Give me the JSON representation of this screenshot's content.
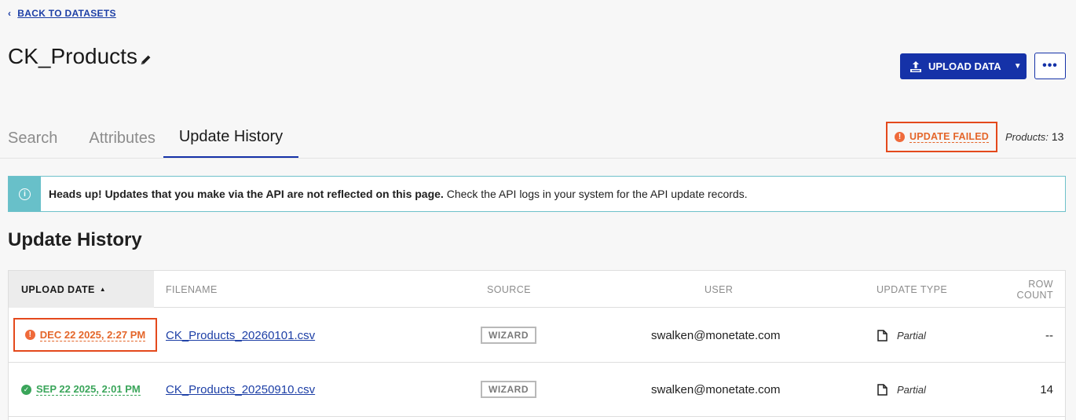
{
  "nav": {
    "back_label": "BACK TO DATASETS"
  },
  "header": {
    "title": "CK_Products",
    "upload_label": "UPLOAD DATA",
    "more_label": "•••"
  },
  "tabs": [
    {
      "label": "Search",
      "active": false
    },
    {
      "label": "Attributes",
      "active": false
    },
    {
      "label": "Update History",
      "active": true
    }
  ],
  "status": {
    "label": "UPDATE FAILED",
    "products_label": "Products:",
    "products_count": "13"
  },
  "banner": {
    "bold_text": "Heads up! Updates that you make via the API are not reflected on this page.",
    "text": " Check the API logs in your system for the API update records."
  },
  "section_title": "Update History",
  "table": {
    "columns": {
      "upload_date": "UPLOAD DATE",
      "filename": "FILENAME",
      "source": "SOURCE",
      "user": "USER",
      "update_type": "UPDATE TYPE",
      "row_count_1": "ROW",
      "row_count_2": "COUNT"
    },
    "rows": [
      {
        "status": "failed",
        "date": "DEC 22 2025, 2:27 PM",
        "filename": "CK_Products_20260101.csv",
        "source": "WIZARD",
        "user": "swalken@monetate.com",
        "update_type": "Partial",
        "row_count": "--"
      },
      {
        "status": "success",
        "date": "SEP 22 2025, 2:01 PM",
        "filename": "CK_Products_20250910.csv",
        "source": "WIZARD",
        "user": "swalken@monetate.com",
        "update_type": "Partial",
        "row_count": "14"
      }
    ]
  },
  "colors": {
    "accent": "#1532a8",
    "error": "#e4662a",
    "success": "#3aa55a",
    "info": "#68c0c9"
  },
  "icons": [
    "chevron-left-icon",
    "pencil-icon",
    "upload-icon",
    "caret-down-icon",
    "alert-icon",
    "info-icon",
    "check-icon",
    "file-icon"
  ]
}
